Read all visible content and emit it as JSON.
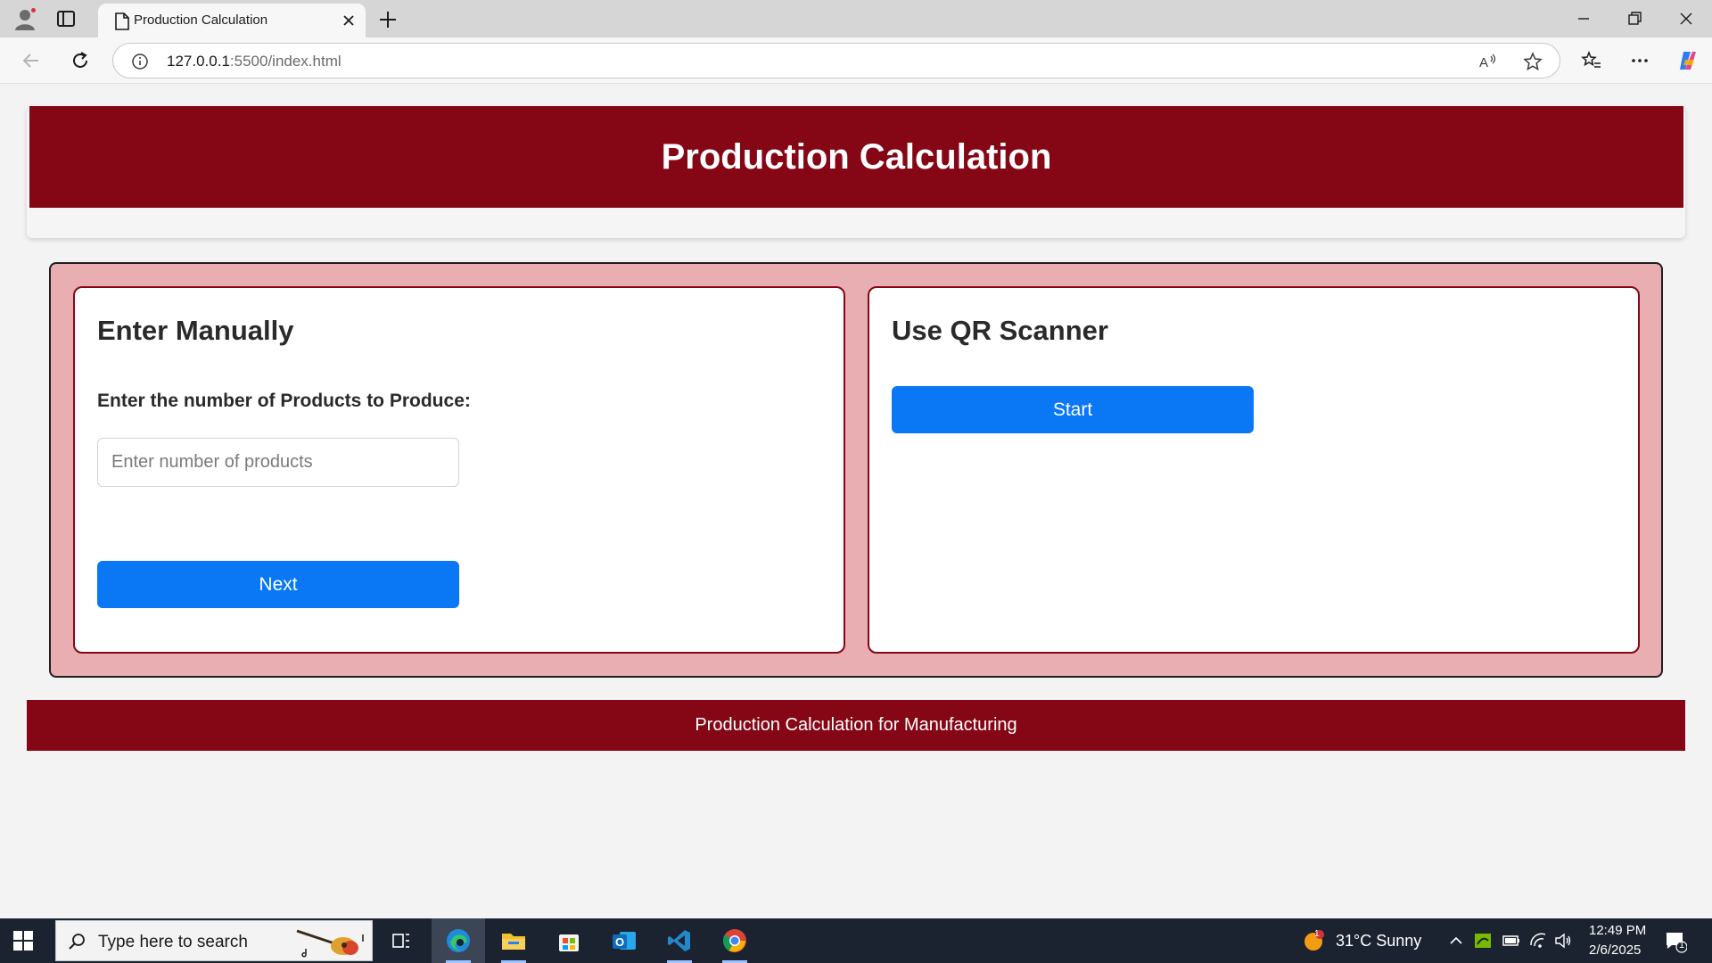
{
  "browser": {
    "tab_title": "Production Calculation",
    "url_host": "127.0.0.1",
    "url_rest": ":5500/index.html"
  },
  "page": {
    "header_title": "Production Calculation",
    "manual": {
      "heading": "Enter Manually",
      "label": "Enter the number of Products to Produce:",
      "input_placeholder": "Enter number of products",
      "input_value": "",
      "next_label": "Next"
    },
    "qr": {
      "heading": "Use QR Scanner",
      "start_label": "Start"
    },
    "footer_text": "Production Calculation for Manufacturing",
    "colors": {
      "brand_maroon": "#850716",
      "panel_pink": "#e8aeb2",
      "button_blue": "#0a78f5"
    }
  },
  "taskbar": {
    "search_placeholder": "Type here to search",
    "weather": "31°C  Sunny",
    "weather_badge": "1",
    "time": "12:49 PM",
    "date": "2/6/2025",
    "notification_count": "1",
    "apps": [
      "task-view",
      "edge",
      "file-explorer",
      "microsoft-store",
      "outlook",
      "vscode",
      "chrome"
    ]
  }
}
